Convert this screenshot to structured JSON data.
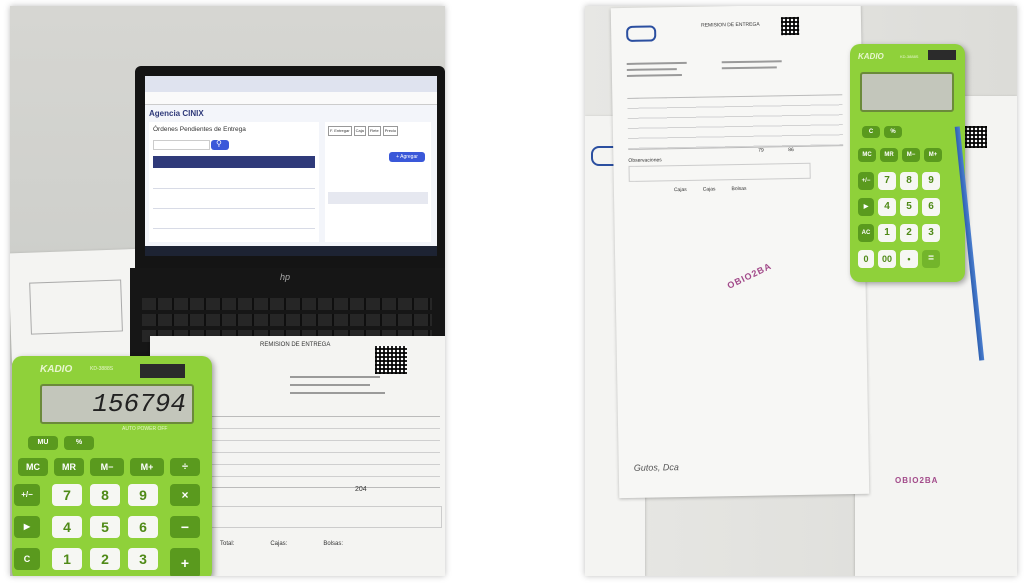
{
  "left_photo": {
    "laptop": {
      "app_title": "Agencia CINIX",
      "panel_title": "Órdenes Pendientes de Entrega",
      "buttons": [
        "F. Entregar",
        "Caja",
        "Flete",
        "Precio"
      ],
      "add_button": "+ Agregar",
      "brand_logo": "hp"
    },
    "calculator": {
      "brand": "KADIO",
      "model": "KD-3888S",
      "display": "156794",
      "mode_label": "AUTO POWER OFF",
      "keys": [
        "MU",
        "%",
        "MC",
        "MR",
        "M−",
        "M+",
        "÷",
        "+/−",
        "7",
        "8",
        "9",
        "×",
        "▶",
        "4",
        "5",
        "6",
        "−",
        "C",
        "1",
        "2",
        "3",
        "+"
      ]
    },
    "document": {
      "title": "REMISION DE ENTREGA",
      "total_value": "204",
      "footer_fields": [
        "Total:",
        "Cajas:",
        "Bolsas:"
      ]
    }
  },
  "right_photo": {
    "document": {
      "title": "REMISION DE ENTREGA",
      "section_label": "Observaciones",
      "footer_fields": [
        "Cajas",
        "Cajas",
        "Bolsas"
      ],
      "totals": [
        "79",
        "86"
      ],
      "handwritten": "Gutos, Dca"
    },
    "stamp_text": "OBIO2BA",
    "calculator": {
      "brand": "KADIO",
      "model": "KD-3888S",
      "display": "",
      "keys": [
        "C",
        "%",
        "MC",
        "MR",
        "M−",
        "M+",
        "+/−",
        "7",
        "8",
        "9",
        "▶",
        "4",
        "5",
        "6",
        "AC",
        "1",
        "2",
        "3",
        "0",
        "00",
        "•",
        "="
      ]
    }
  }
}
